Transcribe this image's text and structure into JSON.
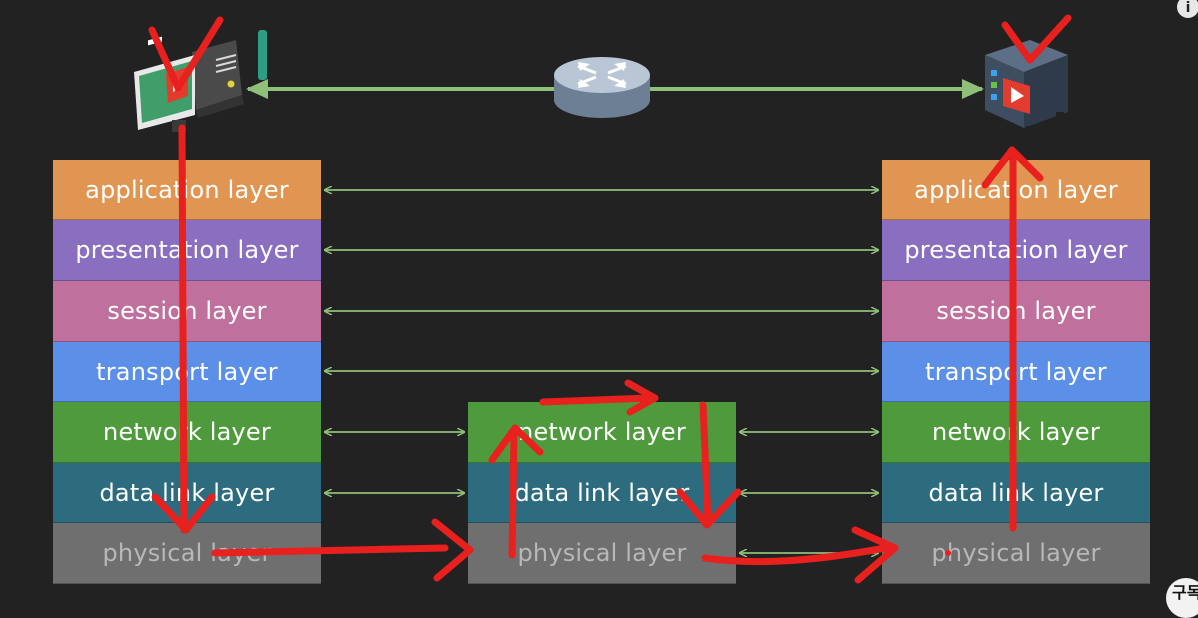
{
  "colors": {
    "background": "#222222",
    "link_arrow": "#8fc07a",
    "annotation": "#e8201e",
    "application": "#e09552",
    "presentation": "#8a6fc0",
    "session": "#c0709d",
    "transport": "#5b8fe8",
    "network": "#4f9a3d",
    "datalink": "#2d6b7e",
    "physical": "#6f6f6f"
  },
  "stacks": {
    "left": [
      {
        "key": "application",
        "label": "application layer"
      },
      {
        "key": "presentation",
        "label": "presentation layer"
      },
      {
        "key": "session",
        "label": "session layer"
      },
      {
        "key": "transport",
        "label": "transport layer"
      },
      {
        "key": "network",
        "label": "network layer"
      },
      {
        "key": "datalink",
        "label": "data link layer"
      },
      {
        "key": "physical",
        "label": "physical layer"
      }
    ],
    "middle": [
      {
        "key": "network",
        "label": "network layer"
      },
      {
        "key": "datalink",
        "label": "data link layer"
      },
      {
        "key": "physical",
        "label": "physical layer"
      }
    ],
    "right": [
      {
        "key": "application",
        "label": "application layer"
      },
      {
        "key": "presentation",
        "label": "presentation layer"
      },
      {
        "key": "session",
        "label": "session layer"
      },
      {
        "key": "transport",
        "label": "transport layer"
      },
      {
        "key": "network",
        "label": "network layer"
      },
      {
        "key": "datalink",
        "label": "data link layer"
      },
      {
        "key": "physical",
        "label": "physical layer"
      }
    ]
  },
  "icons": {
    "client": "client-computer-icon",
    "router": "router-icon",
    "server": "video-server-icon",
    "info": "info-icon",
    "badge": "channel-badge-icon"
  },
  "ui": {
    "info_glyph": "i",
    "badge_text": "구독"
  }
}
